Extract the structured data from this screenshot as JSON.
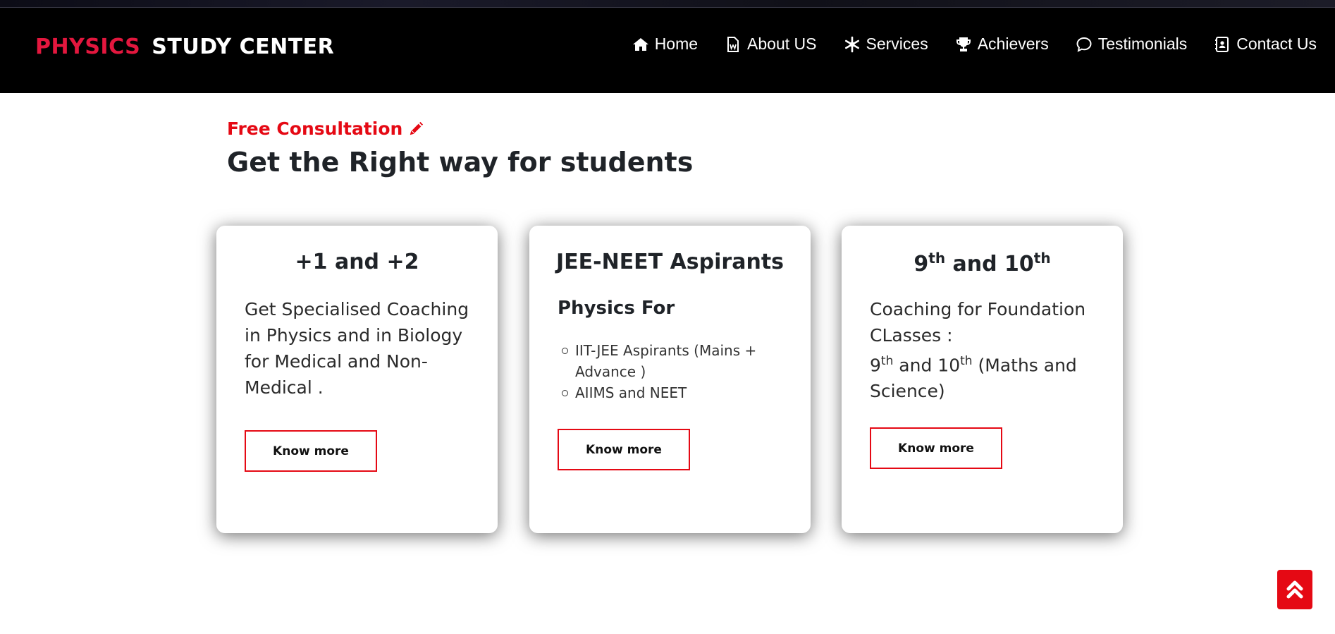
{
  "brand": {
    "part1": "PHYSICS",
    "part2": "STUDY CENTER"
  },
  "nav": {
    "items": [
      {
        "label": "Home",
        "icon": "home-icon"
      },
      {
        "label": "About US",
        "icon": "document-icon"
      },
      {
        "label": "Services",
        "icon": "snowflake-icon"
      },
      {
        "label": "Achievers",
        "icon": "trophy-icon"
      },
      {
        "label": "Testimonials",
        "icon": "chat-icon"
      },
      {
        "label": "Contact Us",
        "icon": "contact-icon"
      }
    ]
  },
  "section": {
    "eyebrow": "Free Consultation",
    "eyebrow_icon": "pencil-icon",
    "headline": "Get the Right way for students"
  },
  "cards": [
    {
      "title": "+1 and +2",
      "text": "Get Specialised Coaching in Physics and in Biology for Medical and Non-Medical .",
      "button": "Know more"
    },
    {
      "title": "JEE-NEET Aspirants",
      "subtitle": "Physics For",
      "list": [
        "IIT-JEE Aspirants (Mains + Advance )",
        "AIIMS and NEET"
      ],
      "button": "Know more"
    },
    {
      "title_num1": "9",
      "title_sup1": "th",
      "title_mid": " and 10",
      "title_sup2": "th",
      "text_line1": "Coaching for Foundation CLasses :",
      "text_num1": "9",
      "text_sup1": "th",
      "text_mid": " and 10",
      "text_sup2": "th",
      "text_tail": " (Maths and Science)",
      "button": "Know more"
    }
  ],
  "colors": {
    "accent": "#e50914",
    "brand_red": "#e3173e",
    "navbar_bg": "#000000"
  },
  "scroll_top_icon": "double-chevron-up-icon"
}
